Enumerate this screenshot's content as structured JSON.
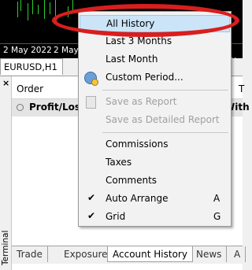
{
  "chart": {
    "dates": [
      "2 May 2022",
      "2 May 2022",
      "2 May"
    ],
    "candle_color": "#2bd12b"
  },
  "chart_tabs": {
    "active": "EURUSD,H1"
  },
  "terminal": {
    "close_label": "×",
    "title": "Terminal",
    "columns": [
      "Order",
      "T"
    ],
    "row": {
      "label": "Profit/Loss",
      "suffix": "With"
    }
  },
  "bottom_tabs": [
    {
      "label": "Trade",
      "active": false
    },
    {
      "label": "Exposure",
      "active": false
    },
    {
      "label": "Account History",
      "active": true
    },
    {
      "label": "News",
      "active": false
    },
    {
      "label": "A",
      "active": false
    }
  ],
  "menu": {
    "items": {
      "all_history": "All History",
      "last_3_months": "Last 3 Months",
      "last_month": "Last Month",
      "custom_period": "Custom Period...",
      "save_report": "Save as Report",
      "save_detailed_report": "Save as Detailed Report",
      "commissions": "Commissions",
      "taxes": "Taxes",
      "comments": "Comments",
      "auto_arrange": "Auto Arrange",
      "auto_arrange_shortcut": "A",
      "grid": "Grid",
      "grid_shortcut": "G",
      "check": "✔"
    },
    "highlight_color": "#cce4f7",
    "annotation_color": "#d81e1e"
  }
}
